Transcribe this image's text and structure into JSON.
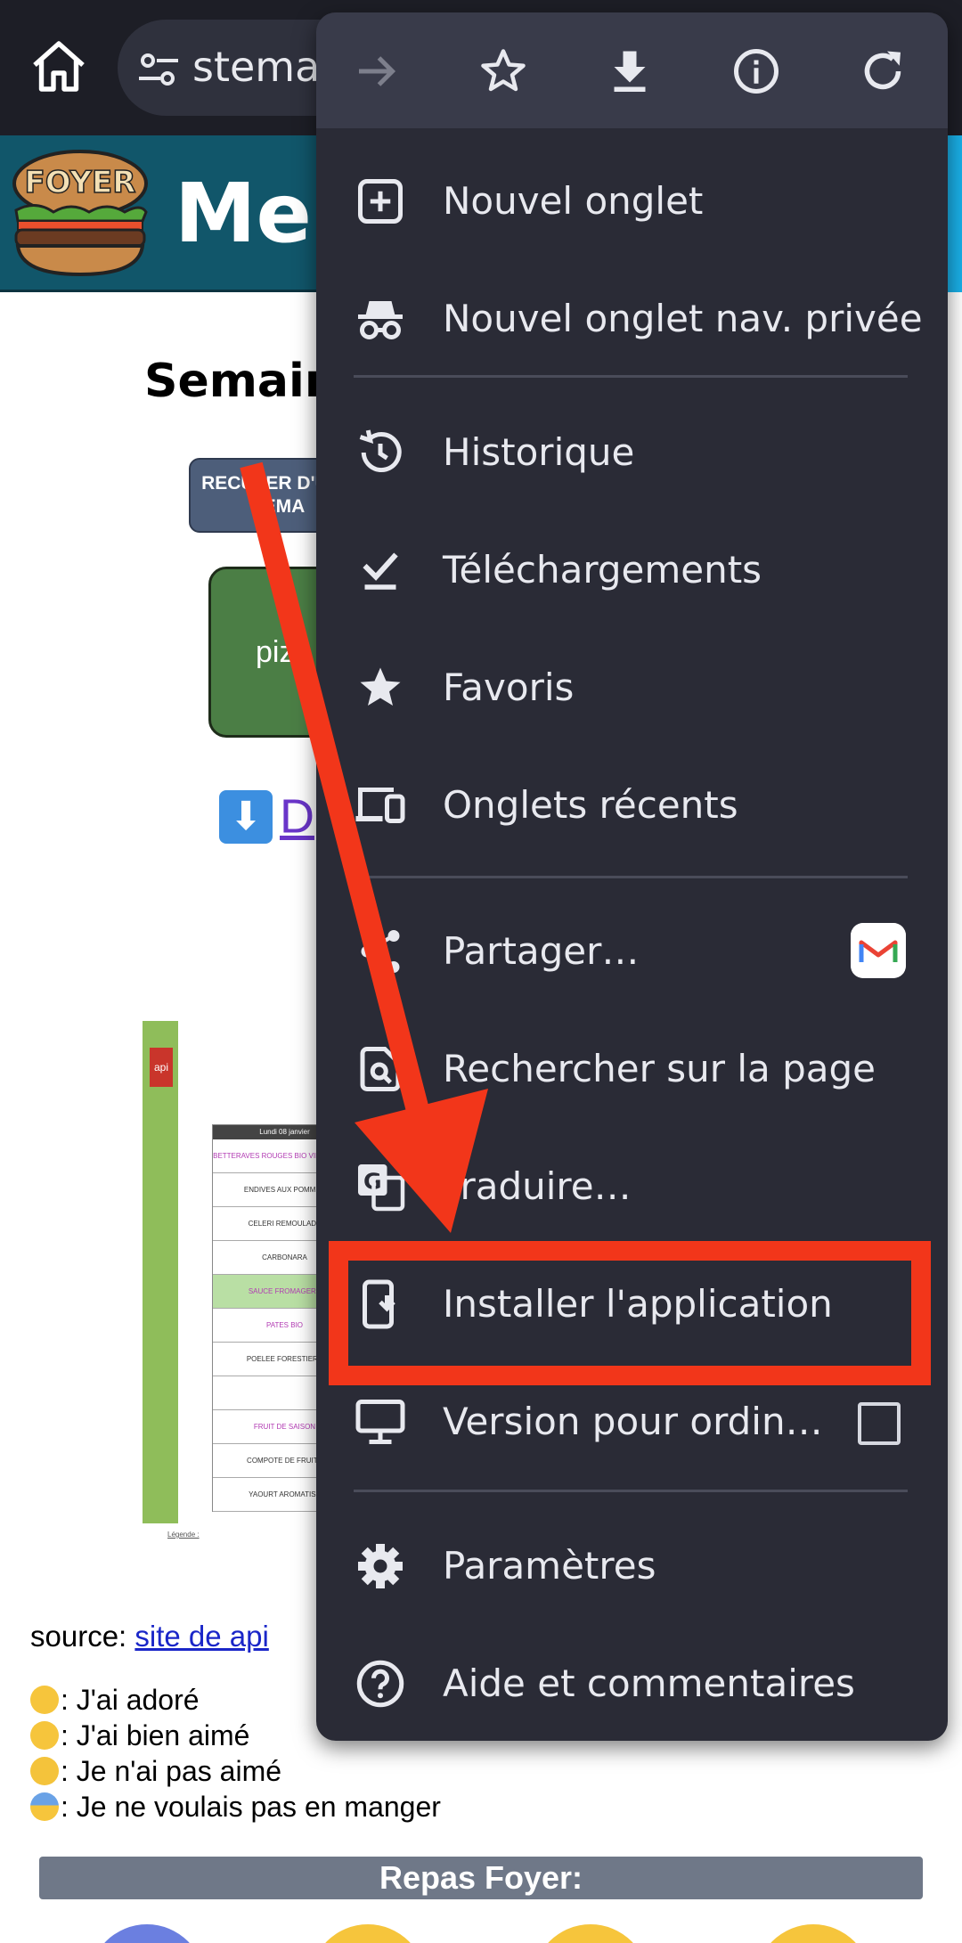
{
  "browser": {
    "url_fragment": "stemari",
    "toolbar_icons": [
      "forward-arrow-icon",
      "bookmark-star-icon",
      "download-icon",
      "page-info-icon",
      "reload-icon"
    ]
  },
  "site": {
    "logo_text": "FOYER",
    "title": "Men"
  },
  "page": {
    "week_title": "Semaine",
    "prev_week_button": "RECULER D'UNE SEMA",
    "meal_card_text": "piz",
    "download_link": "D",
    "menu_image": {
      "api_tag": "api",
      "header": "Lundi 08 janvier",
      "rows": [
        {
          "text": "BETTERAVES ROUGES BIO VINAIGRETTE",
          "style": "purple"
        },
        {
          "text": "ENDIVES AUX POMMES",
          "style": ""
        },
        {
          "text": "CELERI REMOULADE",
          "style": ""
        },
        {
          "text": "CARBONARA",
          "style": ""
        },
        {
          "text": "SAUCE FROMAGERE",
          "style": "green"
        },
        {
          "text": "PATES BIO",
          "style": "purple"
        },
        {
          "text": "POELEE FORESTIERE",
          "style": ""
        },
        {
          "text": "",
          "style": ""
        },
        {
          "text": "FRUIT DE SAISON",
          "style": "purple"
        },
        {
          "text": "COMPOTE DE FRUITS",
          "style": ""
        },
        {
          "text": "YAOURT AROMATISE",
          "style": ""
        }
      ],
      "legend": "Légende :"
    },
    "source_label": "source: ",
    "source_link": "site de api",
    "legend": [
      {
        "emoji": "yum-face",
        "text": ": J'ai adoré"
      },
      {
        "emoji": "smile-face",
        "text": ": J'ai bien aimé"
      },
      {
        "emoji": "frown-face",
        "text": ": Je n'ai pas aimé"
      },
      {
        "emoji": "fearful-face",
        "text": ": Je ne voulais pas en manger"
      }
    ],
    "repas_title": "Repas Foyer:"
  },
  "menu": {
    "items": {
      "new_tab": "Nouvel onglet",
      "incognito_tab": "Nouvel onglet nav. privée",
      "history": "Historique",
      "downloads": "Téléchargements",
      "bookmarks": "Favoris",
      "recent_tabs": "Onglets récents",
      "share": "Partager…",
      "find_in_page": "Rechercher sur la page",
      "translate": "Traduire…",
      "install_app": "Installer l'application",
      "desktop_site": "Version pour ordin…",
      "settings": "Paramètres",
      "help": "Aide et commentaires"
    },
    "desktop_site_checked": false
  },
  "colors": {
    "menu_bg": "#2a2b36",
    "menu_toolbar_bg": "#393b4a",
    "annotation_red": "#f2361a",
    "header_teal": "#11566a"
  }
}
